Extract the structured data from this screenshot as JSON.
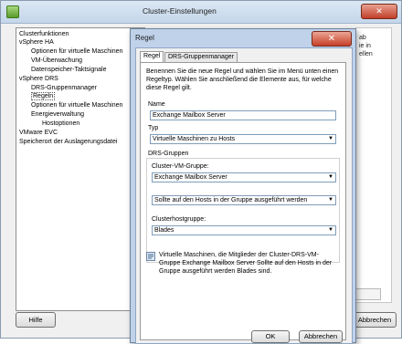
{
  "outer_dialog": {
    "title": "Cluster-Einstellungen",
    "close_glyph": "✕",
    "tree": [
      {
        "label": "Clusterfunktionen",
        "indent": 0
      },
      {
        "label": "vSphere HA",
        "indent": 0
      },
      {
        "label": "Optionen für virtuelle Maschinen",
        "indent": 1
      },
      {
        "label": "VM-Überwachung",
        "indent": 1
      },
      {
        "label": "Datenspeicher-Taktsignale",
        "indent": 1
      },
      {
        "label": "vSphere DRS",
        "indent": 0
      },
      {
        "label": "DRS-Gruppenmanager",
        "indent": 1
      },
      {
        "label": "Regeln",
        "indent": 1,
        "selected": true
      },
      {
        "label": "Optionen für virtuelle Maschinen",
        "indent": 1
      },
      {
        "label": "Energieverwaltung",
        "indent": 1
      },
      {
        "label": "Hostoptionen",
        "indent": 2
      },
      {
        "label": "VMware EVC",
        "indent": 0
      },
      {
        "label": "Speicherort der Auslagerungsdatei",
        "indent": 0
      }
    ],
    "right_peek_text": [
      "ab",
      "ie in",
      "ellen"
    ],
    "help_button": "Hilfe",
    "cancel_button": "Abbrechen"
  },
  "rule_dialog": {
    "title": "Regel",
    "close_glyph": "✕",
    "tabs": [
      "Regel",
      "DRS-Gruppenmanager"
    ],
    "intro": "Benennen Sie die neue Regel und wählen Sie im Menü unten einen Regeltyp. Wählen Sie anschließend die Elemente aus, für welche diese Regel gilt.",
    "name_label": "Name",
    "name_value": "Exchange Mailbox Server",
    "type_label": "Typ",
    "type_value": "Virtuelle Maschinen zu Hosts",
    "drs_groups_label": "DRS-Gruppen",
    "vm_group_label": "Cluster-VM-Gruppe:",
    "vm_group_value": "Exchange Mailbox Server",
    "relation_value": "Sollte auf den Hosts in der Gruppe ausgeführt werden",
    "host_group_label": "Clusterhostgruppe:",
    "host_group_value": "Blades",
    "info_text": "Virtuelle Maschinen, die Mitglieder der Cluster-DRS-VM-Gruppe Exchange Mailbox Server Sollte auf den Hosts in der Gruppe ausgeführt werden Blades sind.",
    "ok_button": "OK",
    "cancel_button": "Abbrechen",
    "dropdown_glyph": "▼"
  },
  "colors": {
    "title_bar": "#c4d6ea",
    "close_button": "#c63f28",
    "field_border": "#7f9db9"
  }
}
